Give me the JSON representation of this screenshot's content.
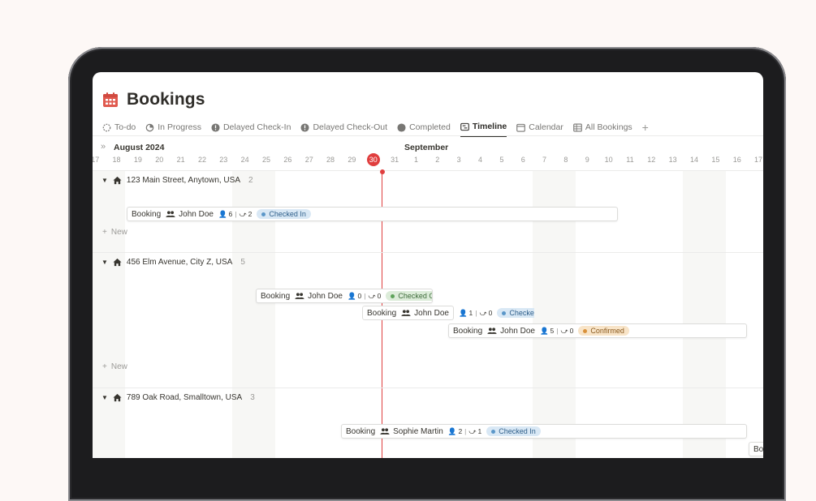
{
  "page": {
    "title": "Bookings"
  },
  "tabs": [
    {
      "label": "To-do",
      "icon": "dashed-circle-icon"
    },
    {
      "label": "In Progress",
      "icon": "progress-icon"
    },
    {
      "label": "Delayed Check-In",
      "icon": "alert-circle-icon"
    },
    {
      "label": "Delayed Check-Out",
      "icon": "alert-circle-icon"
    },
    {
      "label": "Completed",
      "icon": "filled-circle-icon"
    },
    {
      "label": "Timeline",
      "icon": "timeline-icon",
      "active": true
    },
    {
      "label": "Calendar",
      "icon": "calendar-icon"
    },
    {
      "label": "All Bookings",
      "icon": "table-icon"
    }
  ],
  "timeline": {
    "month_left": "August 2024",
    "month_right": "September",
    "days": [
      "17",
      "18",
      "19",
      "20",
      "21",
      "22",
      "23",
      "24",
      "25",
      "26",
      "27",
      "28",
      "29",
      "30",
      "31",
      "1",
      "2",
      "3",
      "4",
      "5",
      "6",
      "7",
      "8",
      "9",
      "10",
      "11",
      "12",
      "13",
      "14",
      "15",
      "16",
      "17"
    ],
    "today": "30"
  },
  "groups": [
    {
      "name": "123 Main Street, Anytown, USA",
      "count": "2",
      "new_label": "New",
      "bookings": [
        {
          "label": "Booking",
          "guest": "John Doe",
          "adults": "6",
          "children": "2",
          "status": "Checked In"
        }
      ]
    },
    {
      "name": "456 Elm Avenue, City Z, USA",
      "count": "5",
      "new_label": "New",
      "bookings": [
        {
          "label": "Booking",
          "guest": "John Doe",
          "adults": "0",
          "children": "0",
          "status": "Checked Out"
        },
        {
          "label": "Booking",
          "guest": "John Doe",
          "adults": "1",
          "children": "0",
          "status": "Checked In"
        },
        {
          "label": "Booking",
          "guest": "John Doe",
          "adults": "5",
          "children": "0",
          "status": "Confirmed"
        }
      ]
    },
    {
      "name": "789 Oak Road, Smalltown, USA",
      "count": "3",
      "bookings": [
        {
          "label": "Booking",
          "guest": "Sophie Martin",
          "adults": "2",
          "children": "1",
          "status": "Checked In"
        },
        {
          "label": "Bookin"
        }
      ]
    }
  ],
  "colors": {
    "accent_red": "#e03e3e",
    "status_checked_in": "#d9e8f5",
    "status_checked_out": "#dcecd9",
    "status_confirmed": "#f8e4c8"
  }
}
